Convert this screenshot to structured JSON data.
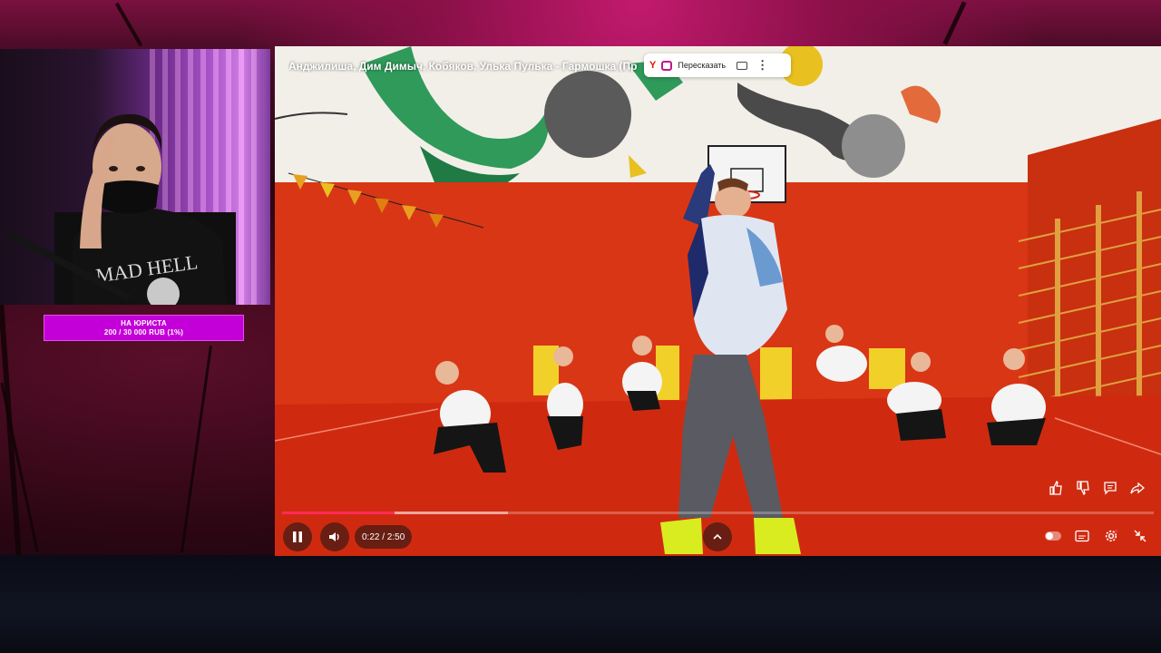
{
  "donation": {
    "title": "НА ЮРИСТА",
    "progress_text": "200 / 30 000 RUB (1%)",
    "progress_fraction": 0.01
  },
  "player": {
    "title": "Анджилиша, Дим Димыч, Кобяков, Улька Пулька - Гармошка (Пр",
    "retell": {
      "brand_letter": "Y",
      "label": "Пересказать"
    },
    "time_display": "0:22 / 2:50",
    "played_fraction": 0.129,
    "buffered_fraction": 0.259,
    "icons": {
      "play_state": "pause-icon",
      "volume": "volume-icon",
      "chapters": "chevron-up-icon",
      "like": "thumbs-up-icon",
      "dislike": "thumbs-down-icon",
      "comments": "comment-icon",
      "share": "share-icon",
      "autoplay": "toggle-icon",
      "subtitles": "subtitles-icon",
      "settings": "gear-icon",
      "fullscreen_exit": "collapse-icon"
    },
    "colors": {
      "progress": "#ff2b5a",
      "retell_accent": "#c0168e",
      "brand_red": "#e61400"
    }
  }
}
